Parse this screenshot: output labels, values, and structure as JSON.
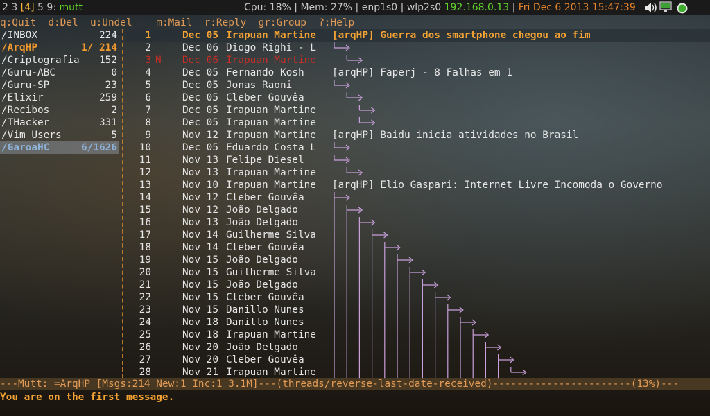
{
  "topbar": {
    "workspaces": [
      "2",
      "3",
      "[4]",
      "5",
      "9",
      ":"
    ],
    "app": "mutt",
    "cpu": "Cpu: 18%",
    "mem": "Mem: 27%",
    "eth": "enp1s0",
    "wlan": "wlp2s0",
    "ip": "192.168.0.13",
    "datetime": "Fri Dec  6 2013 15:47:39",
    "sep": "|",
    "tray_icons": [
      "volume-icon",
      "network-icon",
      "status-icon"
    ]
  },
  "help": {
    "quit": "q:Quit",
    "del": "d:Del",
    "undel": "u:Undel",
    "mail": "m:Mail",
    "reply": "r:Reply",
    "group": "gr:Group",
    "help": "?:Help"
  },
  "sidebar": {
    "items": [
      {
        "name": "/INBOX",
        "count": "224"
      },
      {
        "name": "/ArqHP",
        "count": "1/ 214"
      },
      {
        "name": "/Criptografia",
        "count": "152"
      },
      {
        "name": "/Guru-ABC",
        "count": "0"
      },
      {
        "name": "/Guru-SP",
        "count": "23"
      },
      {
        "name": "/Elixir",
        "count": "259"
      },
      {
        "name": "/Recibos",
        "count": "2"
      },
      {
        "name": "/THacker",
        "count": "331"
      },
      {
        "name": "/Vim Users",
        "count": "5"
      },
      {
        "name": "/GaroaHC",
        "count": "6/1626"
      }
    ]
  },
  "messages": [
    {
      "num": "1",
      "flag": "",
      "date": "Dec 05",
      "from": "Irapuan Martine",
      "subject": "[arqHP] Guerra dos smartphone chegou ao fim"
    },
    {
      "num": "2",
      "flag": "",
      "date": "Dec 06",
      "from": "Diogo Righi - L",
      "subject": ""
    },
    {
      "num": "3",
      "flag": "N",
      "date": "Dec 06",
      "from": "Irapuan Martine",
      "subject": ""
    },
    {
      "num": "4",
      "flag": "",
      "date": "Dec 05",
      "from": "Fernando Kosh",
      "subject": "[arqHP] Faperj - 8 Falhas em 1"
    },
    {
      "num": "5",
      "flag": "",
      "date": "Dec 05",
      "from": "Jonas Raoni",
      "subject": ""
    },
    {
      "num": "6",
      "flag": "",
      "date": "Dec 05",
      "from": "Cleber Gouvêa",
      "subject": ""
    },
    {
      "num": "7",
      "flag": "",
      "date": "Dec 05",
      "from": "Irapuan Martine",
      "subject": ""
    },
    {
      "num": "8",
      "flag": "",
      "date": "Dec 05",
      "from": "Irapuan Martine",
      "subject": ""
    },
    {
      "num": "9",
      "flag": "",
      "date": "Nov 12",
      "from": "Irapuan Martine",
      "subject": "[arqHP] Baidu inicia atividades no Brasil"
    },
    {
      "num": "10",
      "flag": "",
      "date": "Dec 05",
      "from": "Eduardo Costa L",
      "subject": ""
    },
    {
      "num": "11",
      "flag": "",
      "date": "Nov 13",
      "from": "Felipe Diesel",
      "subject": ""
    },
    {
      "num": "12",
      "flag": "",
      "date": "Nov 13",
      "from": "Irapuan Martine",
      "subject": ""
    },
    {
      "num": "13",
      "flag": "",
      "date": "Nov 10",
      "from": "Irapuan Martine",
      "subject": "[arqHP] Elio Gaspari: Internet Livre Incomoda o Governo"
    },
    {
      "num": "14",
      "flag": "",
      "date": "Nov 12",
      "from": "Cleber Gouvêa",
      "subject": ""
    },
    {
      "num": "15",
      "flag": "",
      "date": "Nov 12",
      "from": "João Delgado",
      "subject": ""
    },
    {
      "num": "16",
      "flag": "",
      "date": "Nov 13",
      "from": "João Delgado",
      "subject": ""
    },
    {
      "num": "17",
      "flag": "",
      "date": "Nov 14",
      "from": "Guilherme Silva",
      "subject": ""
    },
    {
      "num": "18",
      "flag": "",
      "date": "Nov 14",
      "from": "Cleber Gouvêa",
      "subject": ""
    },
    {
      "num": "19",
      "flag": "",
      "date": "Nov 15",
      "from": "João Delgado",
      "subject": ""
    },
    {
      "num": "20",
      "flag": "",
      "date": "Nov 15",
      "from": "Guilherme Silva",
      "subject": ""
    },
    {
      "num": "21",
      "flag": "",
      "date": "Nov 15",
      "from": "João Delgado",
      "subject": ""
    },
    {
      "num": "22",
      "flag": "",
      "date": "Nov 15",
      "from": "Cleber Gouvêa",
      "subject": ""
    },
    {
      "num": "23",
      "flag": "",
      "date": "Nov 15",
      "from": "Danillo Nunes",
      "subject": ""
    },
    {
      "num": "24",
      "flag": "",
      "date": "Nov 18",
      "from": "Danillo Nunes",
      "subject": ""
    },
    {
      "num": "25",
      "flag": "",
      "date": "Nov 18",
      "from": "Irapuan Martine",
      "subject": ""
    },
    {
      "num": "26",
      "flag": "",
      "date": "Nov 20",
      "from": "João Delgado",
      "subject": ""
    },
    {
      "num": "27",
      "flag": "",
      "date": "Nov 20",
      "from": "Cleber Gouvêa",
      "subject": ""
    },
    {
      "num": "28",
      "flag": "",
      "date": "Nov 21",
      "from": "Irapuan Martine",
      "subject": ""
    }
  ],
  "status": "---Mutt: =ArqHP [Msgs:214 New:1 Inc:1 3.1M]---(threads/reverse-last-date-received)-----------------------(13%)---",
  "message_line": "You are on the first message.",
  "colors": {
    "accent": "#f3a233",
    "thread_tree": "#c9a0dc",
    "new_message": "#c92e26",
    "ip": "#62d32d"
  }
}
